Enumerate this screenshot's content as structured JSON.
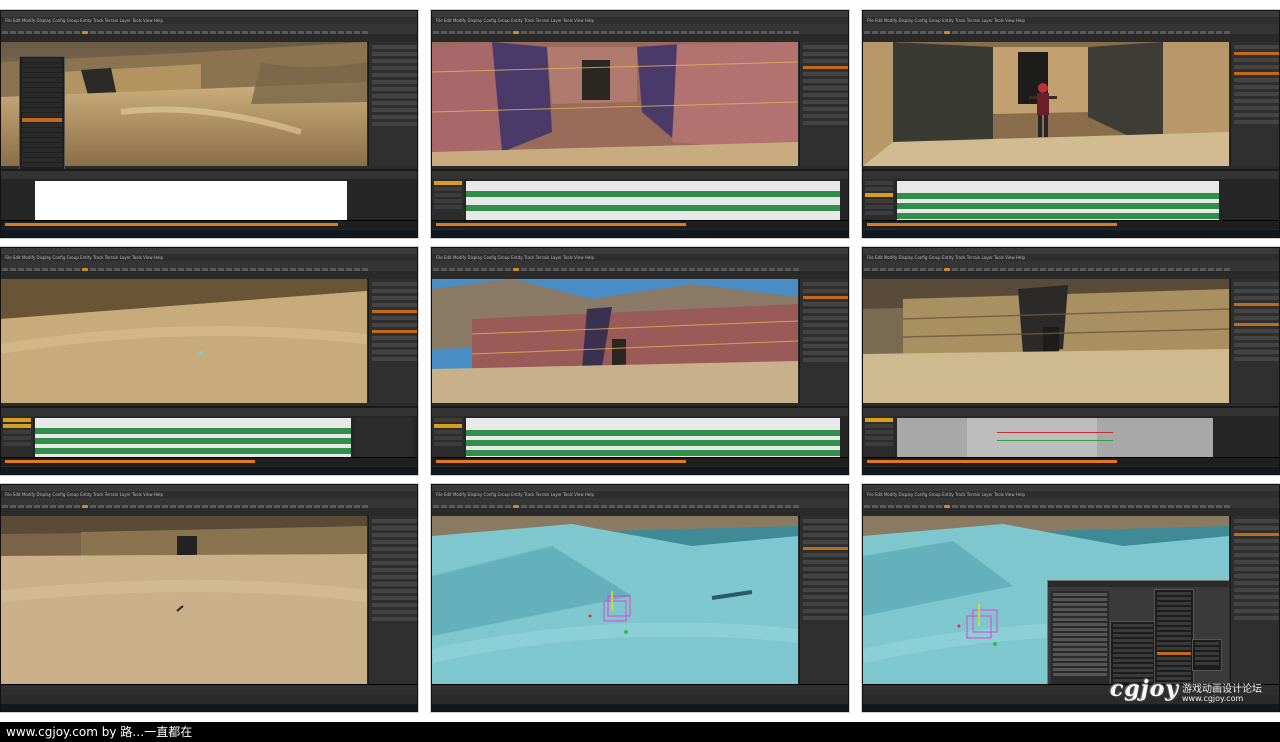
{
  "panels": [
    {
      "id": "p1",
      "scene": "desert-wall",
      "menu": "File  Edit  Modify  Display  Config  Group  Entity  Track  Terrain  Layer  Tools  View  Help",
      "timeline": "white",
      "has_context_menu": true
    },
    {
      "id": "p2",
      "scene": "box-walls",
      "menu": "File  Edit  Modify  Display  Config  Group  Entity  Track  Terrain  Layer  Tools  View  Help",
      "timeline": "green"
    },
    {
      "id": "p3",
      "scene": "character-corridor",
      "menu": "File  Edit  Modify  Display  Config  Group  Entity  Track  Terrain  Layer  Tools  View  Help",
      "timeline": "green"
    },
    {
      "id": "p4",
      "scene": "sand-field",
      "menu": "File  Edit  Modify  Display  Config  Group  Entity  Track  Terrain  Layer  Tools  View  Help",
      "timeline": "green-list"
    },
    {
      "id": "p5",
      "scene": "canyon-building",
      "menu": "File  Edit  Modify  Display  Config  Group  Entity  Track  Terrain  Layer  Tools  View  Help",
      "timeline": "green"
    },
    {
      "id": "p6",
      "scene": "temple-entrance",
      "menu": "File  Edit  Modify  Display  Config  Group  Entity  Track  Terrain  Layer  Tools  View  Help",
      "timeline": "grey"
    },
    {
      "id": "p7",
      "scene": "dunes-far",
      "menu": "File  Edit  Modify  Display  Config  Group  Entity  Track  Terrain  Layer  Tools  View  Help",
      "timeline": "none"
    },
    {
      "id": "p8",
      "scene": "cyan-terrain",
      "menu": "File  Edit  Modify  Display  Config  Group  Entity  Track  Terrain  Layer  Tools  View  Help",
      "timeline": "none"
    },
    {
      "id": "p9",
      "scene": "cyan-terrain-dialog",
      "menu": "File  Edit  Modify  Display  Config  Group  Entity  Track  Terrain  Layer  Tools  View  Help",
      "timeline": "none",
      "has_dialog": true
    }
  ],
  "footer": {
    "credit": "www.cgjoy.com by 路…一直都在"
  },
  "watermark": {
    "logo": "cgjoy",
    "cn": "游戏动画设计论坛",
    "url": "www.cgjoy.com"
  },
  "colors": {
    "accent_orange": "#c26a1a",
    "timeline_green": "#2f8f4a",
    "ui_dark": "#2b2b2b"
  }
}
